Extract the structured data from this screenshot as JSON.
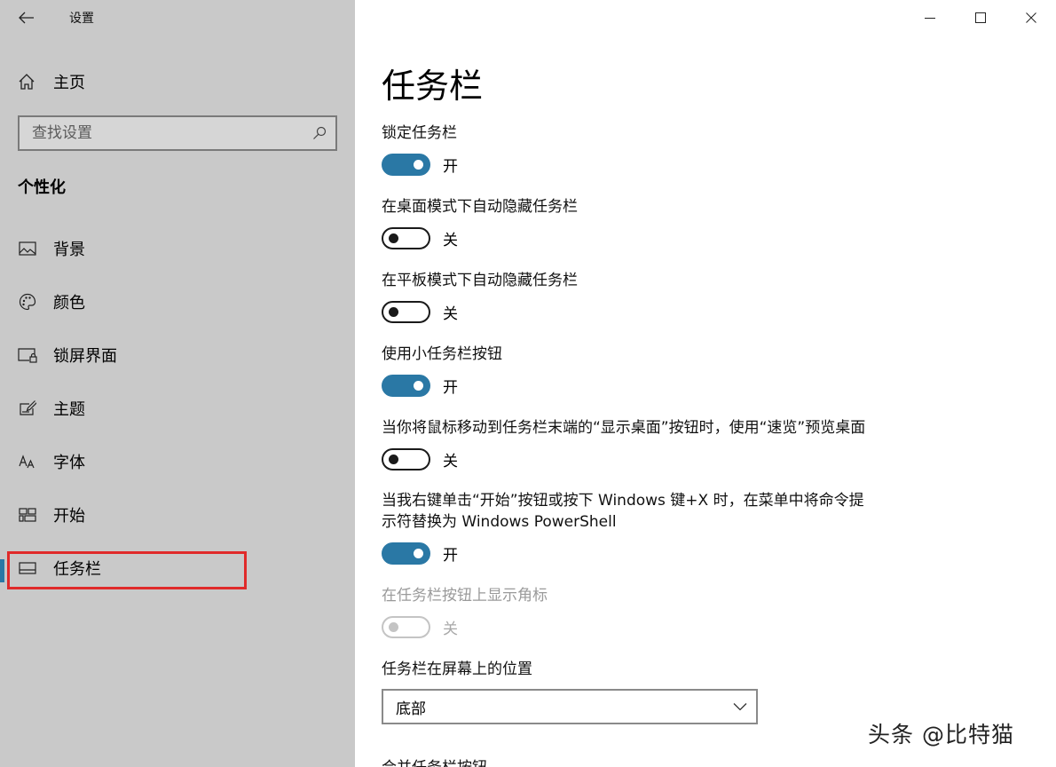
{
  "window": {
    "title": "设置"
  },
  "sidebar": {
    "home_label": "主页",
    "search_placeholder": "查找设置",
    "section_title": "个性化",
    "items": [
      {
        "label": "背景",
        "icon": "picture-icon"
      },
      {
        "label": "颜色",
        "icon": "palette-icon"
      },
      {
        "label": "锁屏界面",
        "icon": "lock-screen-icon"
      },
      {
        "label": "主题",
        "icon": "theme-icon"
      },
      {
        "label": "字体",
        "icon": "font-icon"
      },
      {
        "label": "开始",
        "icon": "start-icon"
      },
      {
        "label": "任务栏",
        "icon": "taskbar-icon",
        "active": true
      }
    ]
  },
  "main": {
    "page_title": "任务栏",
    "settings": [
      {
        "title": "锁定任务栏",
        "state": "开",
        "on": true
      },
      {
        "title": "在桌面模式下自动隐藏任务栏",
        "state": "关",
        "on": false
      },
      {
        "title": "在平板模式下自动隐藏任务栏",
        "state": "关",
        "on": false
      },
      {
        "title": "使用小任务栏按钮",
        "state": "开",
        "on": true
      },
      {
        "title": "当你将鼠标移动到任务栏末端的“显示桌面”按钮时，使用“速览”预览桌面",
        "state": "关",
        "on": false
      },
      {
        "title_line1": "当我右键单击“开始”按钮或按下 Windows 键+X 时，在菜单中将命令提",
        "title_line2": "示符替换为 Windows PowerShell",
        "state": "开",
        "on": true
      },
      {
        "title": "在任务栏按钮上显示角标",
        "state": "关",
        "on": false,
        "disabled": true
      }
    ],
    "position": {
      "title": "任务栏在屏幕上的位置",
      "value": "底部"
    },
    "next_title": "合并任务栏按钮"
  },
  "watermark": "头条 @比特猫",
  "colors": {
    "accent": "#2a78a5",
    "sidebar_bg": "#c9c9c9",
    "highlight": "#e02a2a"
  }
}
